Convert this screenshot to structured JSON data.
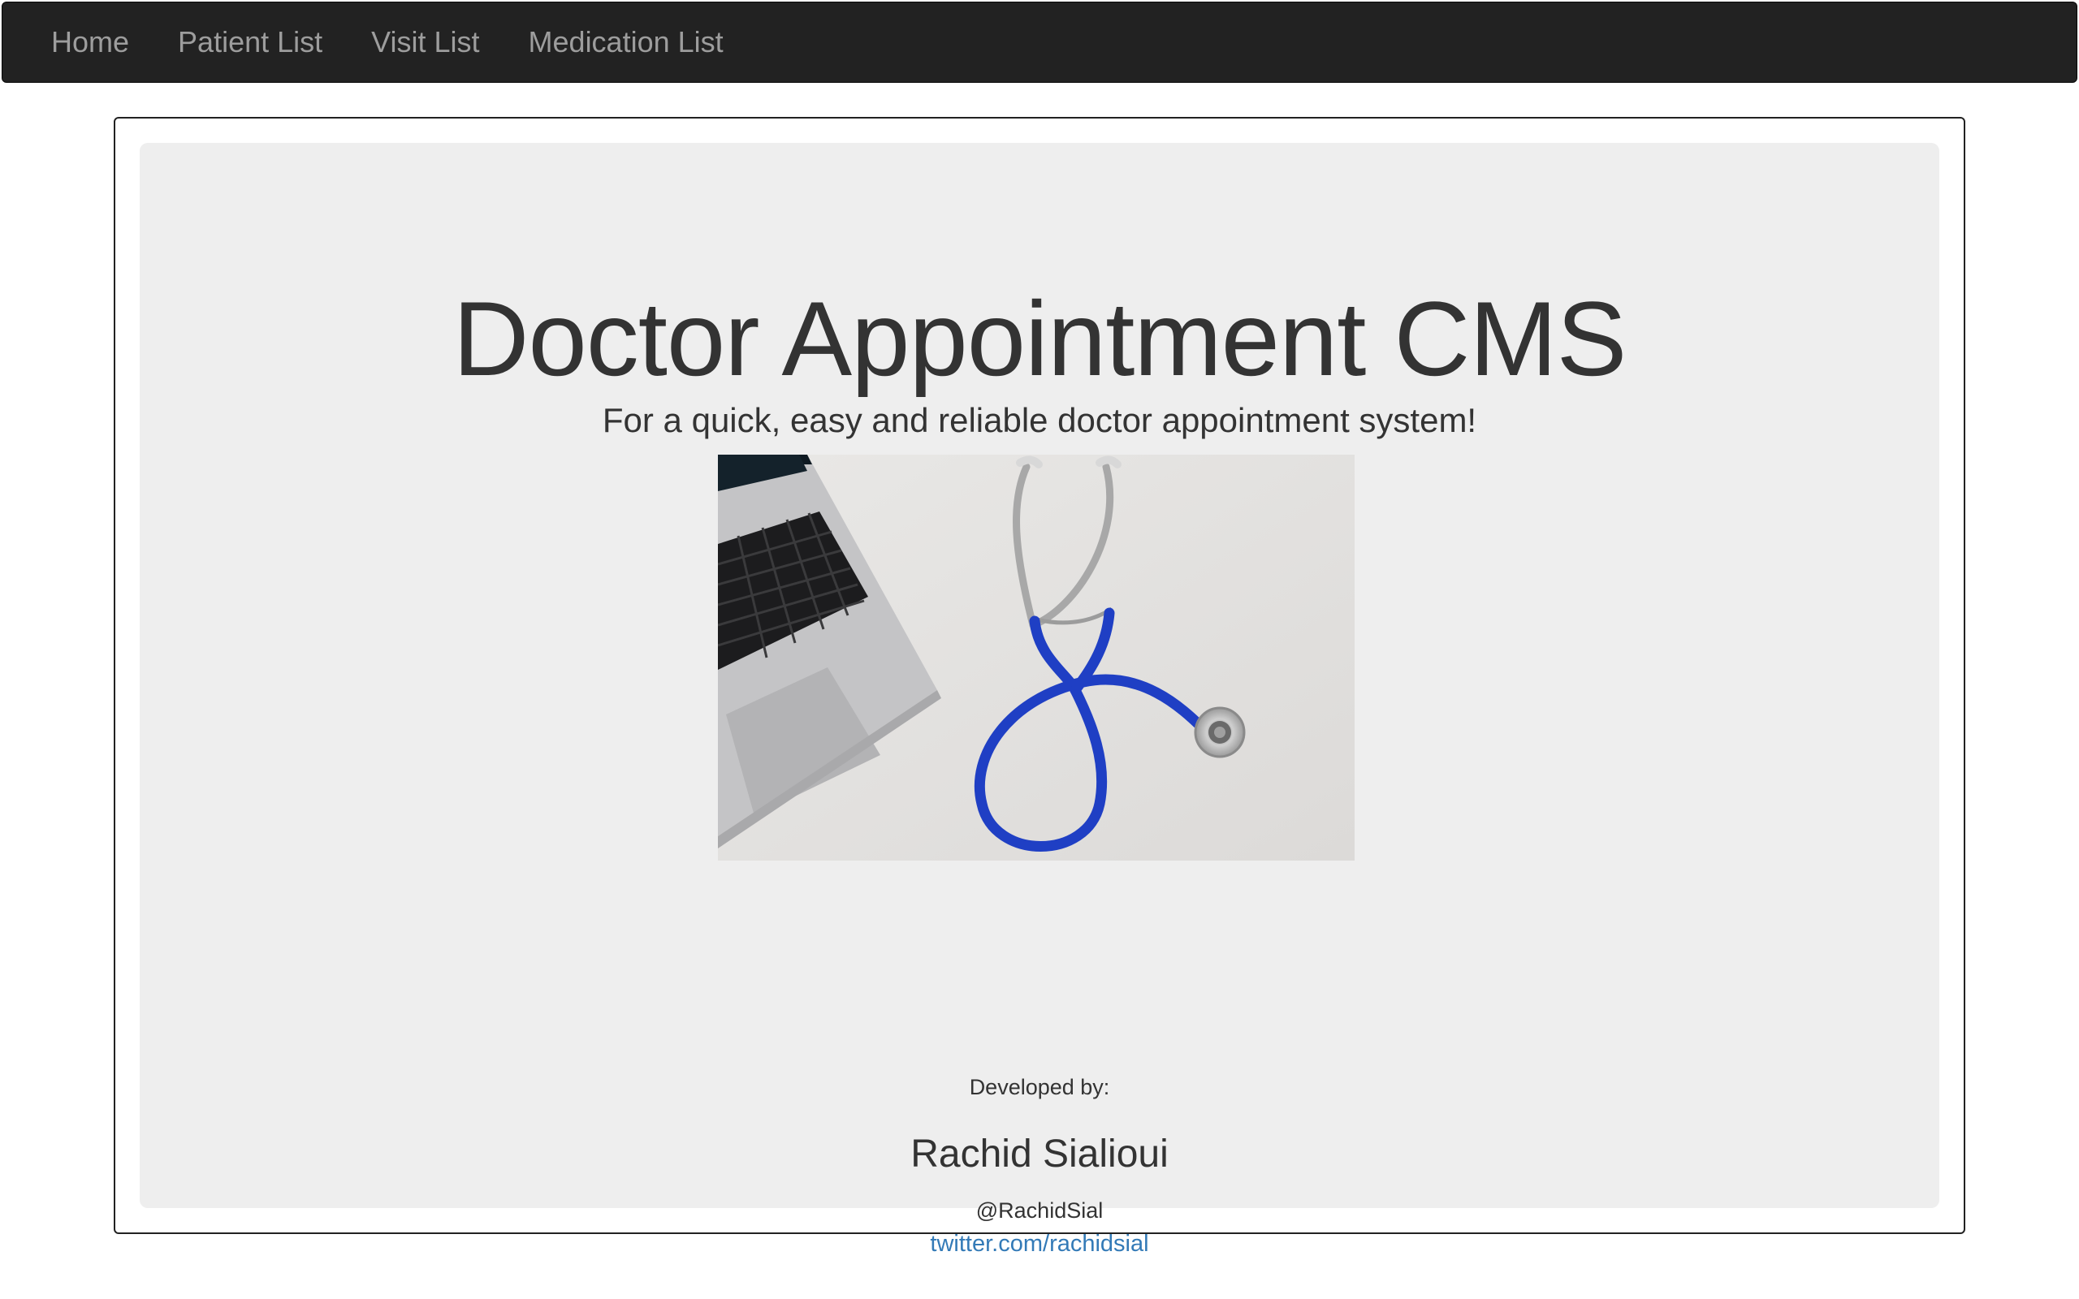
{
  "navbar": {
    "links": [
      {
        "label": "Home"
      },
      {
        "label": "Patient List"
      },
      {
        "label": "Visit List"
      },
      {
        "label": "Medication List"
      }
    ]
  },
  "jumbotron": {
    "title": "Doctor Appointment CMS",
    "subtitle": "For a quick, easy and reliable doctor appointment system!",
    "image": {
      "subject": "laptop-and-stethoscope-photo"
    }
  },
  "credits": {
    "label": "Developed by:",
    "name": "Rachid Sialioui",
    "handle": "@RachidSial",
    "link_text": "twitter.com/rachidsial"
  },
  "colors": {
    "navbar_bg": "#222222",
    "nav_text": "#9d9d9d",
    "jumbotron_bg": "#eeeeee",
    "link": "#337ab7",
    "stethoscope_tube": "#1f3fc4"
  }
}
